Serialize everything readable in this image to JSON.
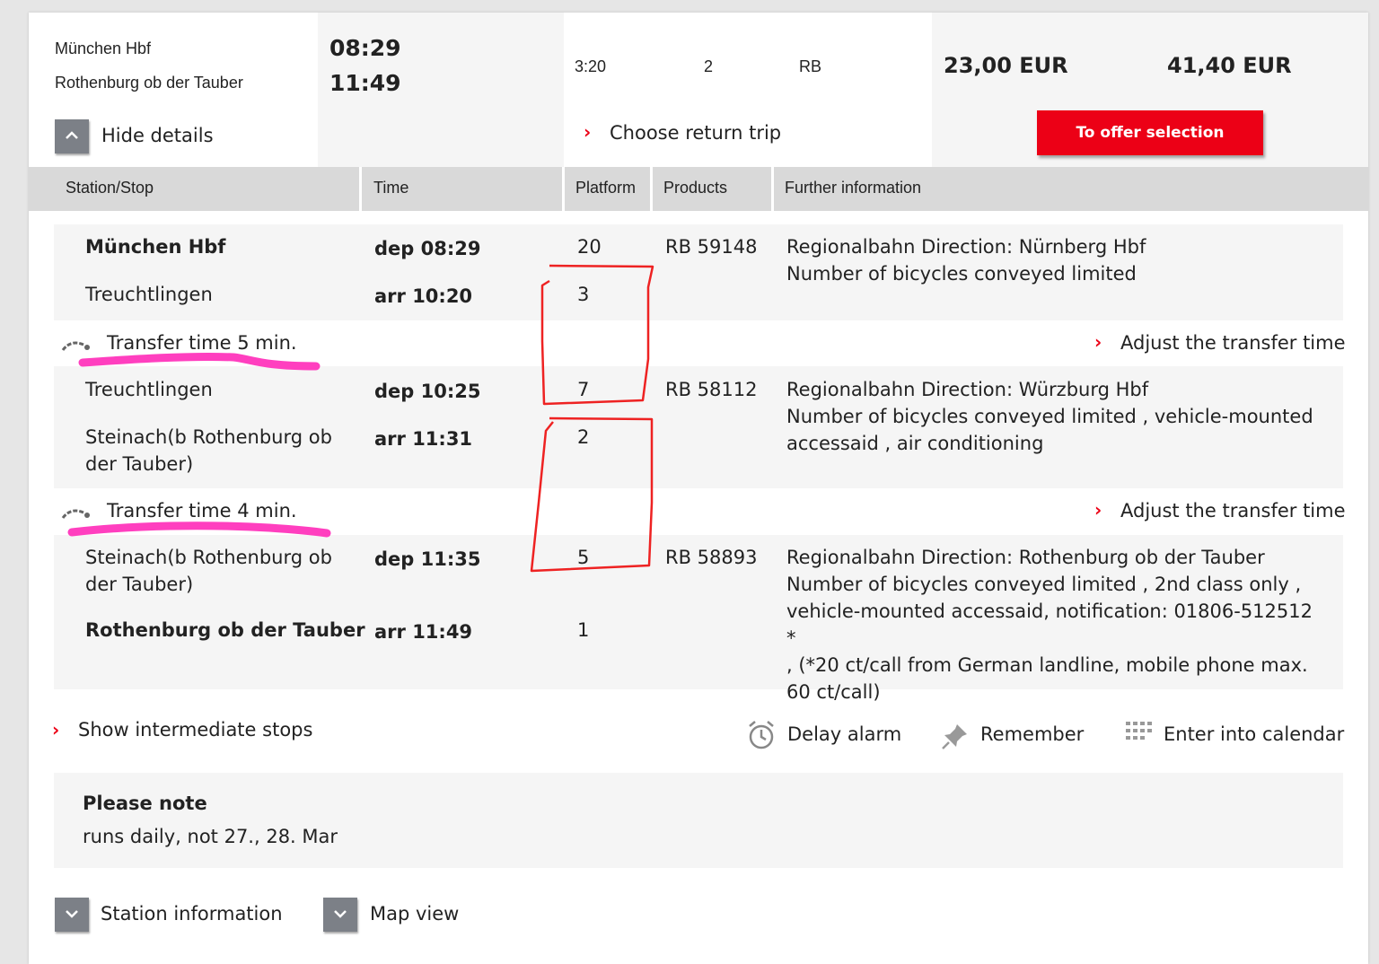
{
  "summary": {
    "from": "München Hbf",
    "to": "Rothenburg ob der Tauber",
    "dep_time": "08:29",
    "arr_time": "11:49",
    "duration": "3:20",
    "changes": "2",
    "products": "RB",
    "hide_details_label": "Hide details",
    "return_trip_label": "Choose return trip",
    "price_1": "23,00 EUR",
    "price_2": "41,40 EUR",
    "offer_button": "To offer selection"
  },
  "table_headers": [
    "Station/Stop",
    "Time",
    "Platform",
    "Products",
    "Further information"
  ],
  "legs": [
    {
      "dep_station": "München Hbf",
      "dep_time": "dep 08:29",
      "dep_platform": "20",
      "arr_station": "Treuchtlingen",
      "arr_time": "arr 10:20",
      "arr_platform": "3",
      "product": "RB 59148",
      "info": [
        "Regionalbahn Direction: Nürnberg Hbf",
        "Number of bicycles conveyed limited"
      ]
    },
    {
      "dep_station": "Treuchtlingen",
      "dep_time": "dep 10:25",
      "dep_platform": "7",
      "arr_station_l1": "Steinach(b Rothenburg ob",
      "arr_station_l2": "der Tauber)",
      "arr_time": "arr 11:31",
      "arr_platform": "2",
      "product": "RB 58112",
      "info": [
        "Regionalbahn Direction: Würzburg Hbf",
        "Number of bicycles conveyed limited , vehicle-mounted",
        "accessaid , air conditioning"
      ]
    },
    {
      "dep_station_l1": "Steinach(b Rothenburg ob",
      "dep_station_l2": "der Tauber)",
      "dep_time": "dep 11:35",
      "dep_platform": "5",
      "arr_station": "Rothenburg ob der Tauber",
      "arr_time": "arr 11:49",
      "arr_platform": "1",
      "product": "RB 58893",
      "info": [
        "Regionalbahn Direction: Rothenburg ob der Tauber",
        "Number of bicycles conveyed limited , 2nd class only ,",
        "vehicle-mounted accessaid, notification: 01806-512512 *",
        ", (*20 ct/call from German landline, mobile phone max.",
        "60 ct/call)"
      ]
    }
  ],
  "transfers": [
    {
      "label": "Transfer time 5 min.",
      "adjust": "Adjust the transfer time"
    },
    {
      "label": "Transfer time 4 min.",
      "adjust": "Adjust the transfer time"
    }
  ],
  "actions": {
    "intermediate_stops": "Show intermediate stops",
    "delay_alarm": "Delay alarm",
    "remember": "Remember",
    "calendar": "Enter into calendar"
  },
  "note": {
    "title": "Please note",
    "text": "runs daily, not 27., 28. Mar"
  },
  "bottom": {
    "station_info": "Station information",
    "map_view": "Map view"
  },
  "colors": {
    "accent_red": "#ec0016",
    "button_grey": "#7c8087",
    "annotation_pink": "#ff3fbf",
    "annotation_red": "#ee2222"
  }
}
